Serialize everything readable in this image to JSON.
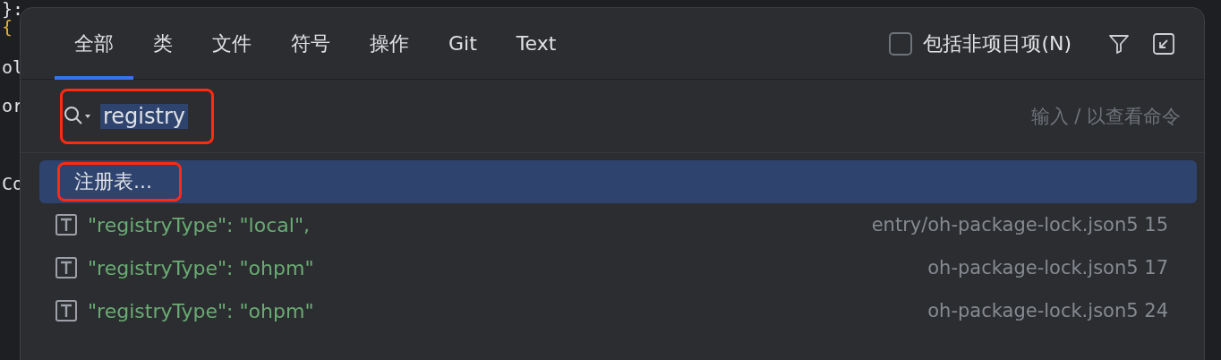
{
  "editor": {
    "lines": [
      {
        "text": "}:",
        "kind": "code"
      },
      {
        "text": "{",
        "kind": "brace"
      },
      {
        "text": "ol",
        "kind": "code"
      },
      {
        "text": "or",
        "kind": "code"
      },
      {
        "text": "Co",
        "kind": "code"
      }
    ]
  },
  "dialog": {
    "tabs": [
      {
        "label": "全部",
        "selected": true
      },
      {
        "label": "类",
        "selected": false
      },
      {
        "label": "文件",
        "selected": false
      },
      {
        "label": "符号",
        "selected": false
      },
      {
        "label": "操作",
        "selected": false
      },
      {
        "label": "Git",
        "selected": false
      },
      {
        "label": "Text",
        "selected": false
      }
    ],
    "include_non_project": {
      "label": "包括非项目项(N)",
      "checked": false
    },
    "search": {
      "value": "registry",
      "hint": "输入 / 以查看命令",
      "highlighted": true
    },
    "results": [
      {
        "kind": "action",
        "label": "注册表...",
        "selected": true,
        "highlighted": true
      },
      {
        "kind": "text",
        "label": "\"registryType\": \"local\",",
        "location": "entry/oh-package-lock.json5 15",
        "selected": false,
        "highlighted": false
      },
      {
        "kind": "text",
        "label": "\"registryType\": \"ohpm\"",
        "location": "oh-package-lock.json5 17",
        "selected": false,
        "highlighted": false
      },
      {
        "kind": "text",
        "label": "\"registryType\": \"ohpm\"",
        "location": "oh-package-lock.json5 24",
        "selected": false,
        "highlighted": false
      }
    ]
  }
}
